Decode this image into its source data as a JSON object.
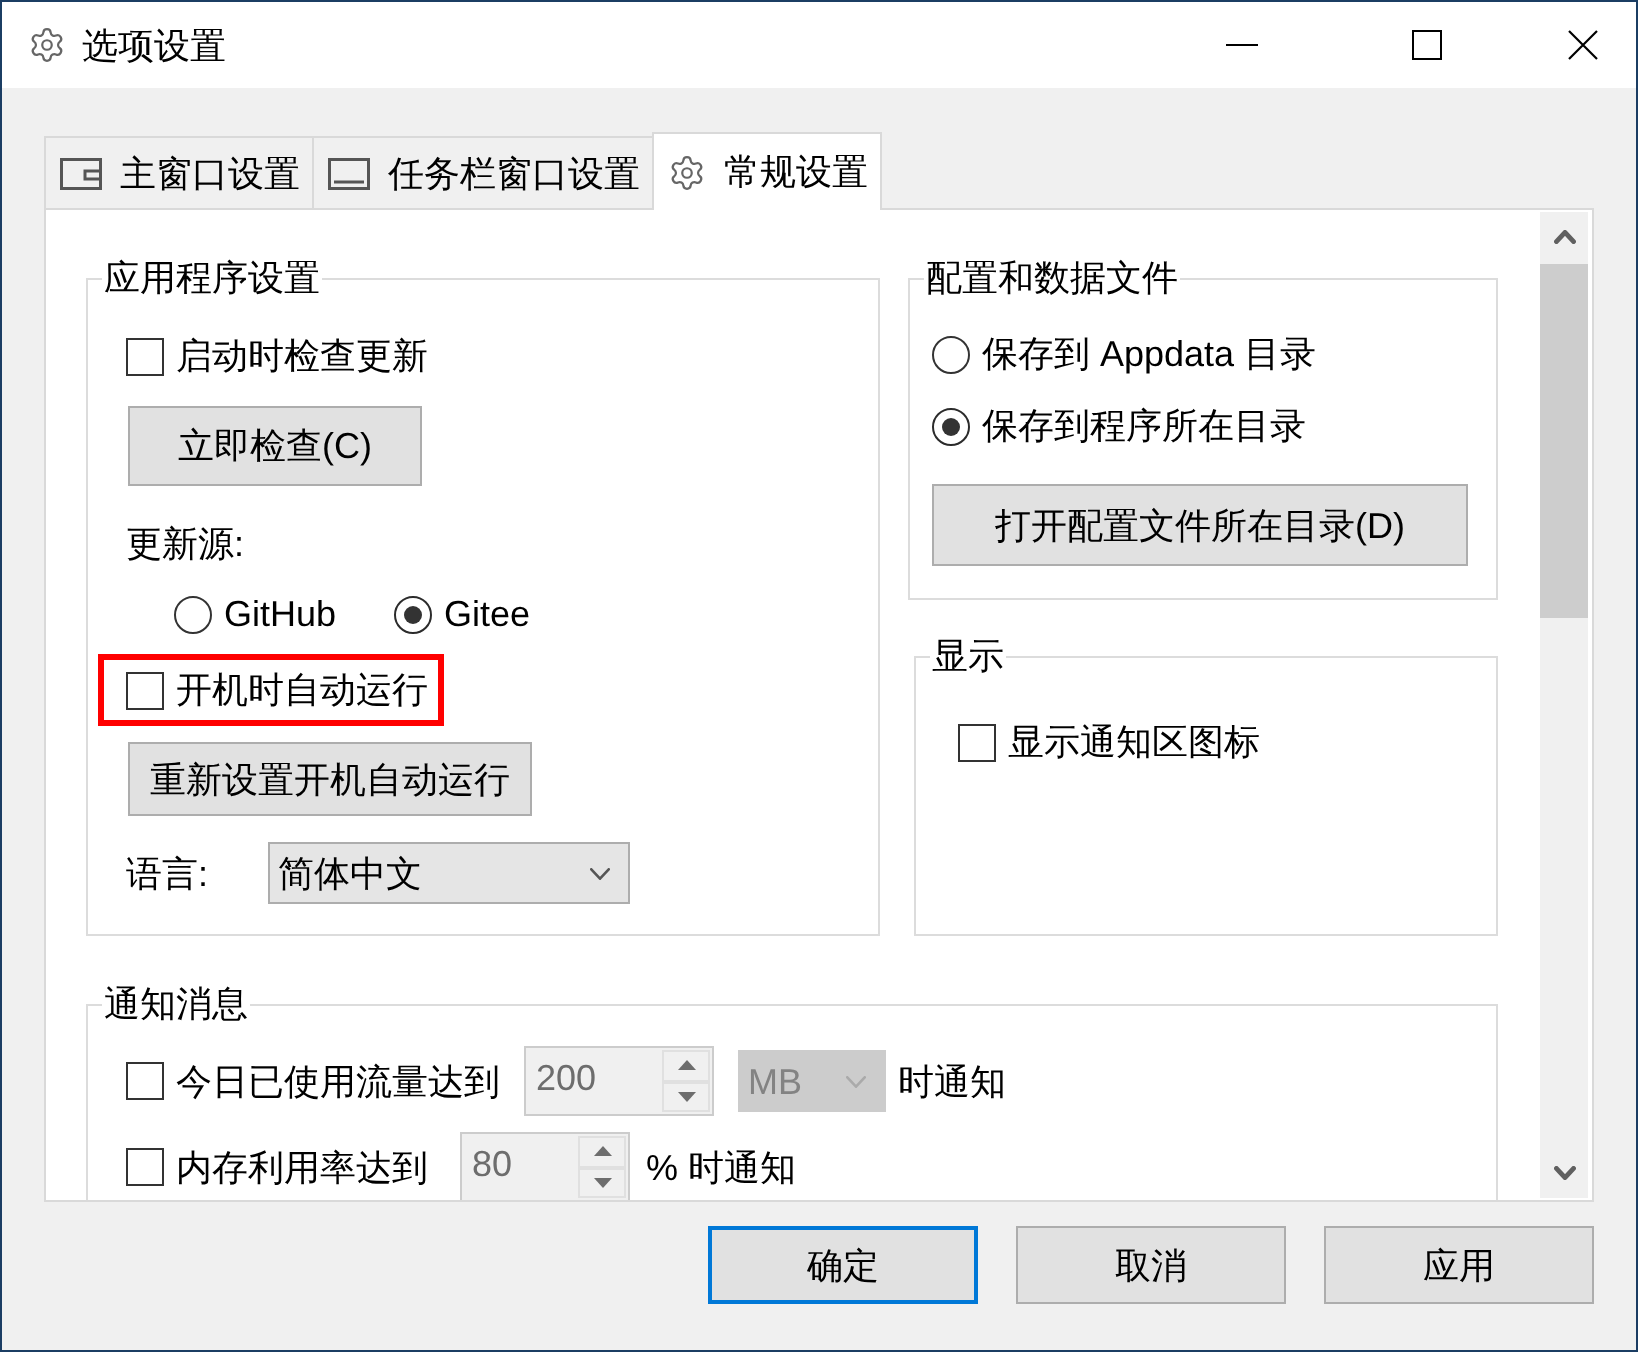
{
  "window": {
    "title": "选项设置"
  },
  "tabs": [
    {
      "label": "主窗口设置",
      "selected": false
    },
    {
      "label": "任务栏窗口设置",
      "selected": false
    },
    {
      "label": "常规设置",
      "selected": true
    }
  ],
  "app_settings": {
    "title": "应用程序设置",
    "check_on_startup": {
      "label": "启动时检查更新",
      "checked": false
    },
    "check_now_button": "立即检查(C)",
    "update_source": {
      "label": "更新源:",
      "options": [
        {
          "label": "GitHub",
          "selected": false
        },
        {
          "label": "Gitee",
          "selected": true
        }
      ]
    },
    "auto_start": {
      "label": "开机时自动运行",
      "checked": false,
      "highlighted": true
    },
    "reset_auto_start_button": "重新设置开机自动运行",
    "language": {
      "label": "语言:",
      "value": "简体中文"
    }
  },
  "config_files": {
    "title": "配置和数据文件",
    "options": [
      {
        "label": "保存到 Appdata 目录",
        "selected": false
      },
      {
        "label": "保存到程序所在目录",
        "selected": true
      }
    ],
    "open_folder_button": "打开配置文件所在目录(D)"
  },
  "display": {
    "title": "显示",
    "show_tray_icon": {
      "label": "显示通知区图标",
      "checked": false
    }
  },
  "notifications": {
    "title": "通知消息",
    "rows": [
      {
        "label": "今日已使用流量达到",
        "checked": false,
        "value": "200",
        "unit": "MB",
        "suffix": "时通知",
        "disabled": true
      },
      {
        "label": "内存利用率达到",
        "checked": false,
        "value": "80",
        "suffix": "% 时通知",
        "disabled": true
      }
    ]
  },
  "buttons": [
    {
      "label": "确定",
      "default": true
    },
    {
      "label": "取消",
      "default": false
    },
    {
      "label": "应用",
      "default": false
    }
  ]
}
